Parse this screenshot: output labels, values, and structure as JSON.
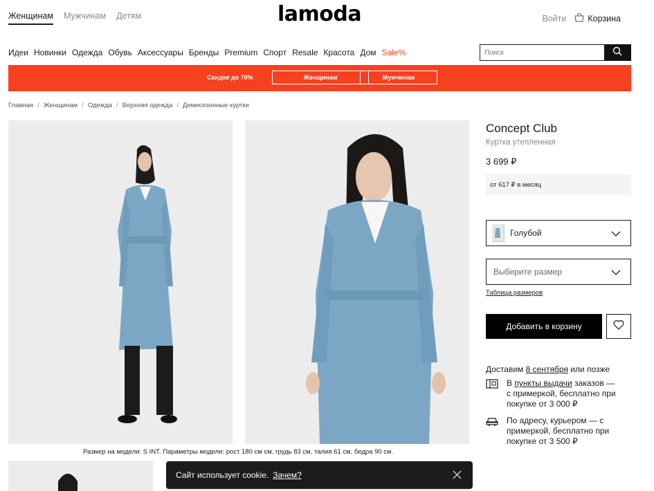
{
  "header": {
    "gender_tabs": [
      "Женщинам",
      "Мужчинам",
      "Детям"
    ],
    "logo": "lamoda",
    "login": "Войти",
    "cart": "Корзина"
  },
  "categories": [
    "Идеи",
    "Новинки",
    "Одежда",
    "Обувь",
    "Аксессуары",
    "Бренды",
    "Premium",
    "Спорт",
    "Resale",
    "Красота",
    "Дом",
    "Sale%"
  ],
  "search": {
    "placeholder": "Поиск"
  },
  "promo": {
    "text": "Скидки до 70%",
    "women": "Женщинам",
    "men": "Мужчинам",
    "color": "#f6401f"
  },
  "breadcrumbs": [
    "Главная",
    "Женщинам",
    "Одежда",
    "Верхняя одежда",
    "Демисезонные куртки"
  ],
  "product": {
    "brand": "Concept Club",
    "type": "Куртка утепленная",
    "price": "3 699 ₽",
    "installment": "от 617 ₽ в месяц",
    "color_value": "Голубой",
    "size_placeholder": "Выберите размер",
    "size_table": "Таблица размеров",
    "add_to_cart": "Добавить в корзину",
    "model_note": "Размер на модели: S INT. Параметры модели: рост 180 см см, грудь 83 см, талия 61 см, бедра 90 см.",
    "jacket_color": "#7ba7c4"
  },
  "delivery": {
    "head_pre": "Доставим",
    "head_date": "8 сентября",
    "head_post": "или позже",
    "pickup_pre": "В",
    "pickup_link": "пункты выдачи",
    "pickup_post": "заказов — с примеркой, бесплатно при покупке от 3 000 ₽",
    "courier": "По адресу, курьером — с примеркой, бесплатно при покупке от 3 500 ₽"
  },
  "cookie": {
    "text": "Сайт использует cookie.",
    "link": "Зачем?"
  },
  "icons": [
    "cart-icon",
    "search-icon",
    "chevron-down-icon",
    "heart-icon",
    "pickup-point-icon",
    "courier-car-icon",
    "close-icon"
  ]
}
